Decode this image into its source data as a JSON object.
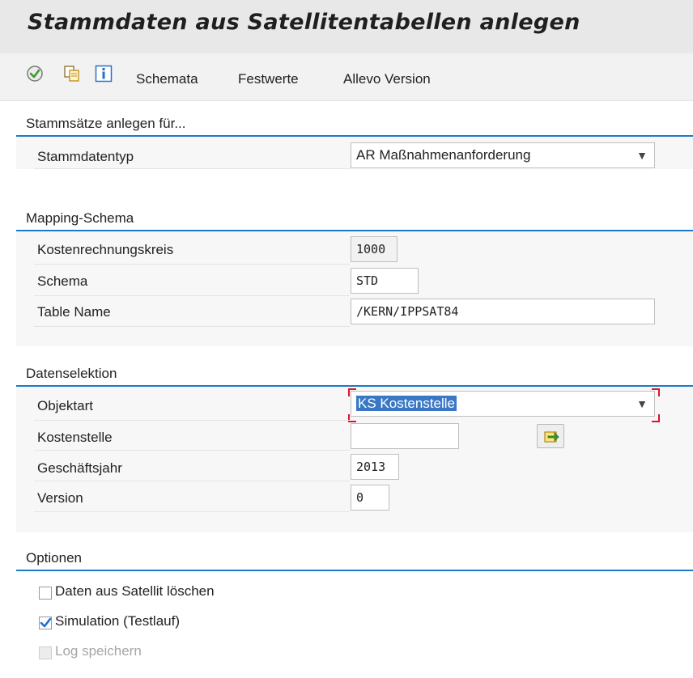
{
  "title": "Stammdaten aus Satellitentabellen anlegen",
  "toolbar": {
    "items": [
      "Schemata",
      "Festwerte",
      "Allevo Version"
    ]
  },
  "group1": {
    "title": "Stammsätze anlegen für...",
    "stammdatentyp_label": "Stammdatentyp",
    "stammdatentyp_value": "AR Maßnahmenanforderung"
  },
  "group2": {
    "title": "Mapping-Schema",
    "kokrs_label": "Kostenrechnungskreis",
    "kokrs_value": "1000",
    "schema_label": "Schema",
    "schema_value": "STD",
    "table_label": "Table Name",
    "table_value": "/KERN/IPPSAT84"
  },
  "group3": {
    "title": "Datenselektion",
    "objektart_label": "Objektart",
    "objektart_value": "KS Kostenstelle",
    "kostenstelle_label": "Kostenstelle",
    "kostenstelle_value": "",
    "jahr_label": "Geschäftsjahr",
    "jahr_value": "2013",
    "version_label": "Version",
    "version_value": "0"
  },
  "group4": {
    "title": "Optionen",
    "opt1": "Daten aus Satellit löschen",
    "opt2": "Simulation (Testlauf)",
    "opt3": "Log speichern"
  }
}
